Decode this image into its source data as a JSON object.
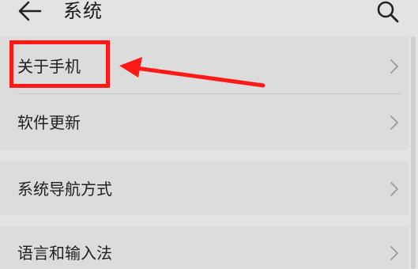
{
  "header": {
    "title": "系统",
    "back_icon": "back-arrow-icon",
    "search_icon": "search-icon"
  },
  "settings": {
    "items": [
      {
        "label": "关于手机"
      },
      {
        "label": "软件更新"
      },
      {
        "label": "系统导航方式"
      },
      {
        "label": "语言和输入法"
      }
    ]
  },
  "annotation": {
    "color": "#ff1a1a"
  }
}
